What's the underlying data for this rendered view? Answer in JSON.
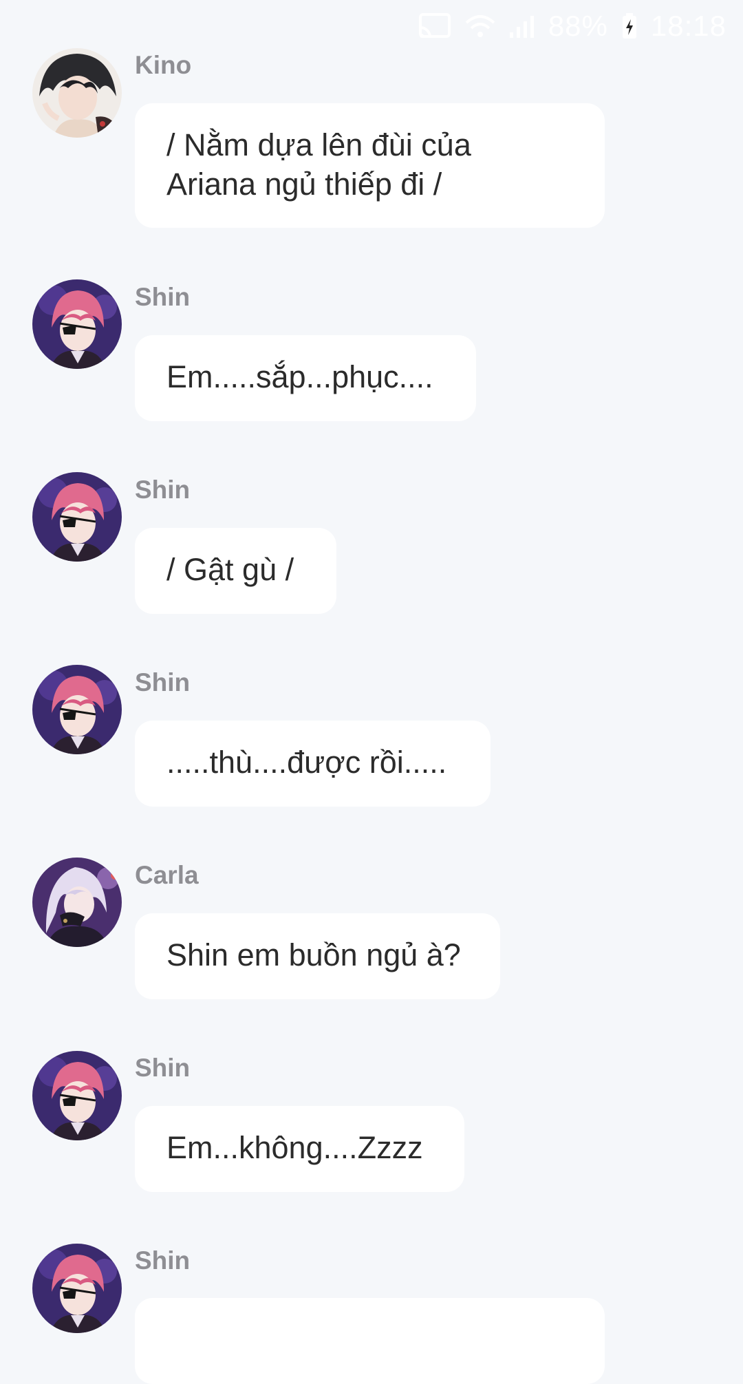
{
  "status_bar": {
    "battery": "88%",
    "time": "18:18",
    "icons": [
      "cast-icon",
      "wifi-icon",
      "signal-icon",
      "battery-charging-icon"
    ]
  },
  "colors": {
    "background": "#f5f7fa",
    "bubble": "#ffffff",
    "sender_name": "#8e8e93",
    "message_text": "#2b2b2b"
  },
  "messages": [
    {
      "sender": "Kino",
      "avatar": "kino-avatar",
      "text": "/ Nằm dựa lên đùi của\nAriana ngủ thiếp đi /"
    },
    {
      "sender": "Shin",
      "avatar": "shin-avatar",
      "text": "Em.....sắp...phục...."
    },
    {
      "sender": "Shin",
      "avatar": "shin-avatar",
      "text": "/ Gật gù /"
    },
    {
      "sender": "Shin",
      "avatar": "shin-avatar",
      "text": ".....thù....được rồi....."
    },
    {
      "sender": "Carla",
      "avatar": "carla-avatar",
      "text": "Shin em buồn ngủ à?"
    },
    {
      "sender": "Shin",
      "avatar": "shin-avatar",
      "text": "Em...không....Zzzz"
    },
    {
      "sender": "Shin",
      "avatar": "shin-avatar",
      "text": ""
    }
  ]
}
